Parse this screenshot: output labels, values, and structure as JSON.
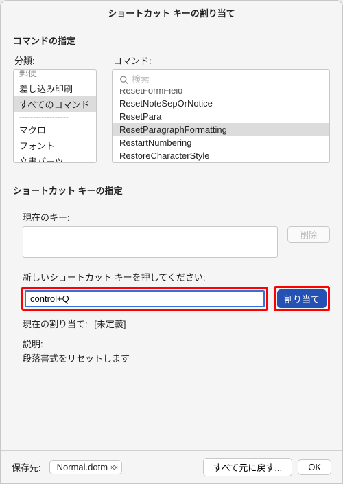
{
  "title": "ショートカット キーの割り当て",
  "section_command": "コマンドの指定",
  "col_category_label": "分類:",
  "col_command_label": "コマンド:",
  "categories": {
    "grayed": "郵便",
    "items": [
      "差し込み印刷",
      "すべてのコマンド",
      "マクロ",
      "フォント",
      "文書パーツ"
    ],
    "selected_index": 1,
    "divider": "------------------"
  },
  "search_placeholder": "検索",
  "commands": {
    "grayed": "ResetFormField",
    "items": [
      "ResetNoteSepOrNotice",
      "ResetPara",
      "ResetParagraphFormatting",
      "RestartNumbering",
      "RestoreCharacterStyle"
    ],
    "selected_index": 2
  },
  "section_keys": "ショートカット キーの指定",
  "label_current": "現在のキー:",
  "btn_delete": "削除",
  "label_newkey": "新しいショートカット キーを押してください:",
  "input_newkey": "control+Q",
  "btn_assign": "割り当て",
  "label_current_assign": "現在の割り当て:",
  "val_undefined": "[未定義]",
  "label_desc": "説明:",
  "desc_text": "段落書式をリセットします",
  "footer_save_label": "保存先:",
  "footer_save_value": "Normal.dotm",
  "btn_reset_all": "すべて元に戻す...",
  "btn_ok": "OK"
}
